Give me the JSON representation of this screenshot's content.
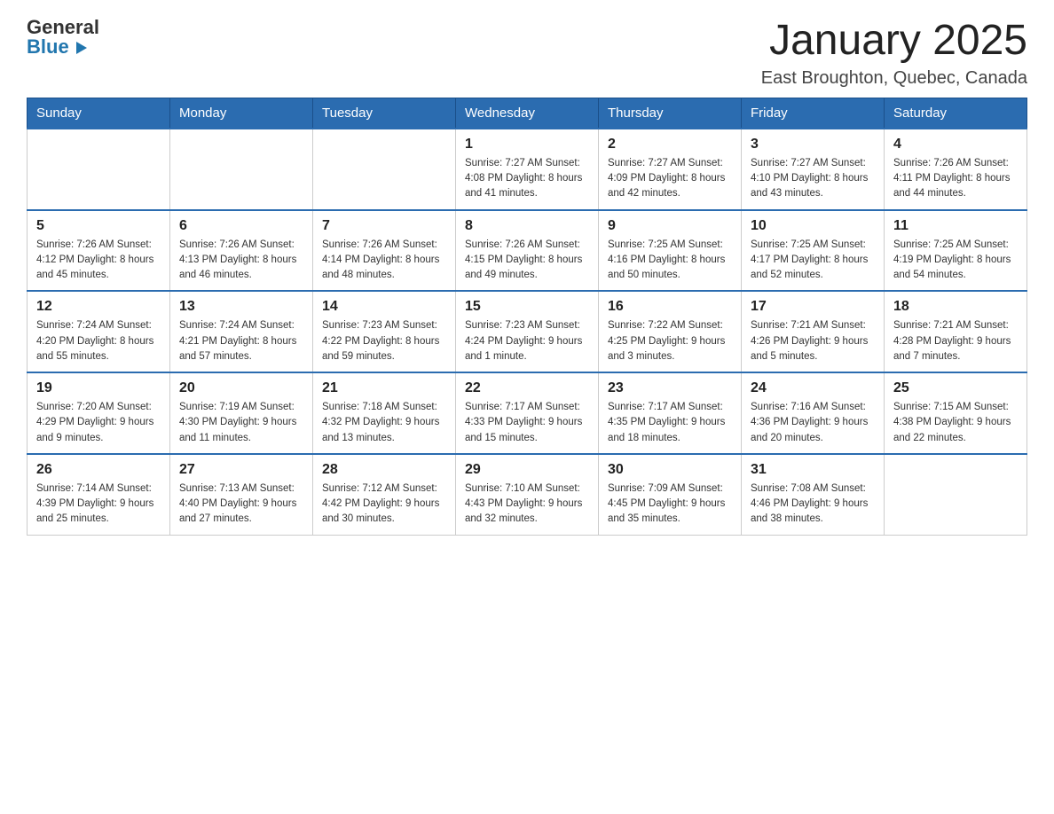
{
  "header": {
    "logo_line1": "General",
    "logo_line2": "Blue",
    "month_title": "January 2025",
    "location": "East Broughton, Quebec, Canada"
  },
  "weekdays": [
    "Sunday",
    "Monday",
    "Tuesday",
    "Wednesday",
    "Thursday",
    "Friday",
    "Saturday"
  ],
  "weeks": [
    [
      {
        "day": "",
        "info": ""
      },
      {
        "day": "",
        "info": ""
      },
      {
        "day": "",
        "info": ""
      },
      {
        "day": "1",
        "info": "Sunrise: 7:27 AM\nSunset: 4:08 PM\nDaylight: 8 hours\nand 41 minutes."
      },
      {
        "day": "2",
        "info": "Sunrise: 7:27 AM\nSunset: 4:09 PM\nDaylight: 8 hours\nand 42 minutes."
      },
      {
        "day": "3",
        "info": "Sunrise: 7:27 AM\nSunset: 4:10 PM\nDaylight: 8 hours\nand 43 minutes."
      },
      {
        "day": "4",
        "info": "Sunrise: 7:26 AM\nSunset: 4:11 PM\nDaylight: 8 hours\nand 44 minutes."
      }
    ],
    [
      {
        "day": "5",
        "info": "Sunrise: 7:26 AM\nSunset: 4:12 PM\nDaylight: 8 hours\nand 45 minutes."
      },
      {
        "day": "6",
        "info": "Sunrise: 7:26 AM\nSunset: 4:13 PM\nDaylight: 8 hours\nand 46 minutes."
      },
      {
        "day": "7",
        "info": "Sunrise: 7:26 AM\nSunset: 4:14 PM\nDaylight: 8 hours\nand 48 minutes."
      },
      {
        "day": "8",
        "info": "Sunrise: 7:26 AM\nSunset: 4:15 PM\nDaylight: 8 hours\nand 49 minutes."
      },
      {
        "day": "9",
        "info": "Sunrise: 7:25 AM\nSunset: 4:16 PM\nDaylight: 8 hours\nand 50 minutes."
      },
      {
        "day": "10",
        "info": "Sunrise: 7:25 AM\nSunset: 4:17 PM\nDaylight: 8 hours\nand 52 minutes."
      },
      {
        "day": "11",
        "info": "Sunrise: 7:25 AM\nSunset: 4:19 PM\nDaylight: 8 hours\nand 54 minutes."
      }
    ],
    [
      {
        "day": "12",
        "info": "Sunrise: 7:24 AM\nSunset: 4:20 PM\nDaylight: 8 hours\nand 55 minutes."
      },
      {
        "day": "13",
        "info": "Sunrise: 7:24 AM\nSunset: 4:21 PM\nDaylight: 8 hours\nand 57 minutes."
      },
      {
        "day": "14",
        "info": "Sunrise: 7:23 AM\nSunset: 4:22 PM\nDaylight: 8 hours\nand 59 minutes."
      },
      {
        "day": "15",
        "info": "Sunrise: 7:23 AM\nSunset: 4:24 PM\nDaylight: 9 hours\nand 1 minute."
      },
      {
        "day": "16",
        "info": "Sunrise: 7:22 AM\nSunset: 4:25 PM\nDaylight: 9 hours\nand 3 minutes."
      },
      {
        "day": "17",
        "info": "Sunrise: 7:21 AM\nSunset: 4:26 PM\nDaylight: 9 hours\nand 5 minutes."
      },
      {
        "day": "18",
        "info": "Sunrise: 7:21 AM\nSunset: 4:28 PM\nDaylight: 9 hours\nand 7 minutes."
      }
    ],
    [
      {
        "day": "19",
        "info": "Sunrise: 7:20 AM\nSunset: 4:29 PM\nDaylight: 9 hours\nand 9 minutes."
      },
      {
        "day": "20",
        "info": "Sunrise: 7:19 AM\nSunset: 4:30 PM\nDaylight: 9 hours\nand 11 minutes."
      },
      {
        "day": "21",
        "info": "Sunrise: 7:18 AM\nSunset: 4:32 PM\nDaylight: 9 hours\nand 13 minutes."
      },
      {
        "day": "22",
        "info": "Sunrise: 7:17 AM\nSunset: 4:33 PM\nDaylight: 9 hours\nand 15 minutes."
      },
      {
        "day": "23",
        "info": "Sunrise: 7:17 AM\nSunset: 4:35 PM\nDaylight: 9 hours\nand 18 minutes."
      },
      {
        "day": "24",
        "info": "Sunrise: 7:16 AM\nSunset: 4:36 PM\nDaylight: 9 hours\nand 20 minutes."
      },
      {
        "day": "25",
        "info": "Sunrise: 7:15 AM\nSunset: 4:38 PM\nDaylight: 9 hours\nand 22 minutes."
      }
    ],
    [
      {
        "day": "26",
        "info": "Sunrise: 7:14 AM\nSunset: 4:39 PM\nDaylight: 9 hours\nand 25 minutes."
      },
      {
        "day": "27",
        "info": "Sunrise: 7:13 AM\nSunset: 4:40 PM\nDaylight: 9 hours\nand 27 minutes."
      },
      {
        "day": "28",
        "info": "Sunrise: 7:12 AM\nSunset: 4:42 PM\nDaylight: 9 hours\nand 30 minutes."
      },
      {
        "day": "29",
        "info": "Sunrise: 7:10 AM\nSunset: 4:43 PM\nDaylight: 9 hours\nand 32 minutes."
      },
      {
        "day": "30",
        "info": "Sunrise: 7:09 AM\nSunset: 4:45 PM\nDaylight: 9 hours\nand 35 minutes."
      },
      {
        "day": "31",
        "info": "Sunrise: 7:08 AM\nSunset: 4:46 PM\nDaylight: 9 hours\nand 38 minutes."
      },
      {
        "day": "",
        "info": ""
      }
    ]
  ]
}
